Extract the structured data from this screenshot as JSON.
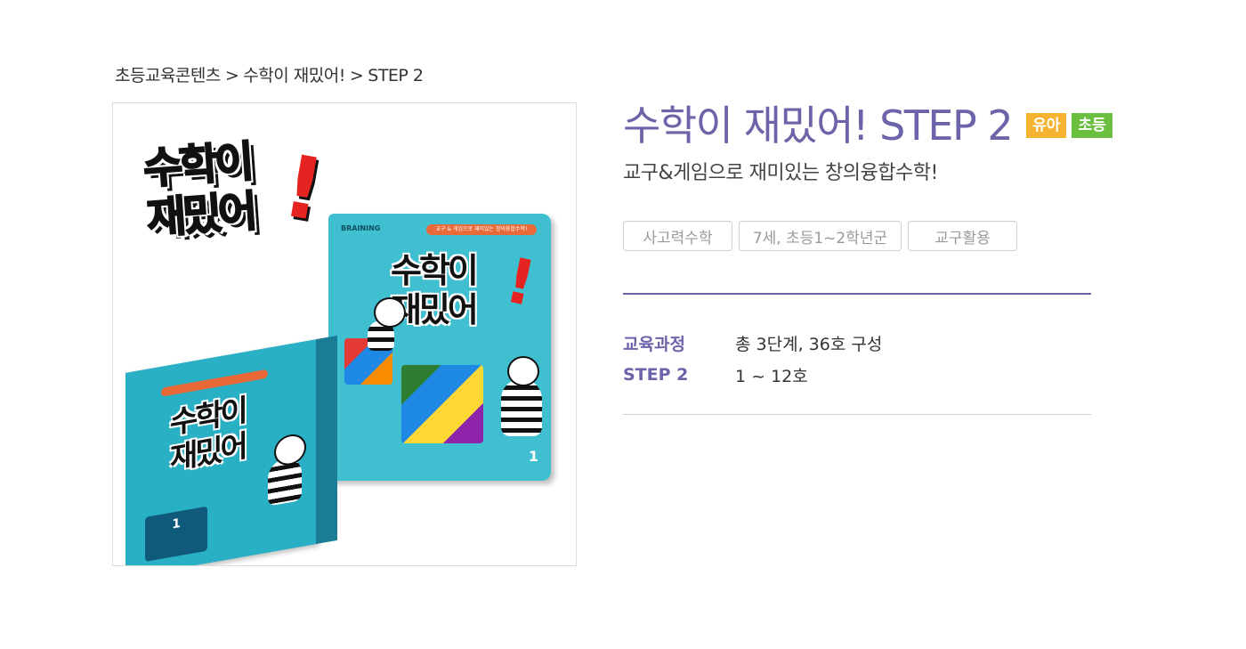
{
  "breadcrumb": {
    "items": [
      "초등교육콘텐츠",
      "수학이 재밌어!",
      "STEP 2"
    ],
    "separator": ">"
  },
  "product": {
    "title": "수학이 재밌어! STEP 2",
    "badges": [
      "유아",
      "초등"
    ],
    "subtitle": "교구&게임으로 재미있는 창의융합수학!",
    "tags": [
      "사고력수학",
      "7세, 초등1~2학년군",
      "교구활용"
    ],
    "info": [
      {
        "label": "교육과정",
        "value": "총 3단계, 36호 구성"
      },
      {
        "label": "STEP 2",
        "value": "1 ~ 12호"
      }
    ]
  },
  "image": {
    "logo_line1": "수학이",
    "logo_line2": "재밌어",
    "logo_bang": "!",
    "book_brand": "BRAINING",
    "book_band": "교구 & 게임으로 재미있는 창의융합수학!",
    "book_title_line1": "수학이",
    "book_title_line2": "재밌어",
    "book_number": "1",
    "box_title_line1": "수학이",
    "box_title_line2": "재밌어",
    "box_number": "1"
  },
  "colors": {
    "accent": "#6b64a8",
    "badge_kid": "#f5b331",
    "badge_elem": "#6bbf3f",
    "book_cover": "#3fbfd0",
    "logo_red": "#e52421"
  }
}
